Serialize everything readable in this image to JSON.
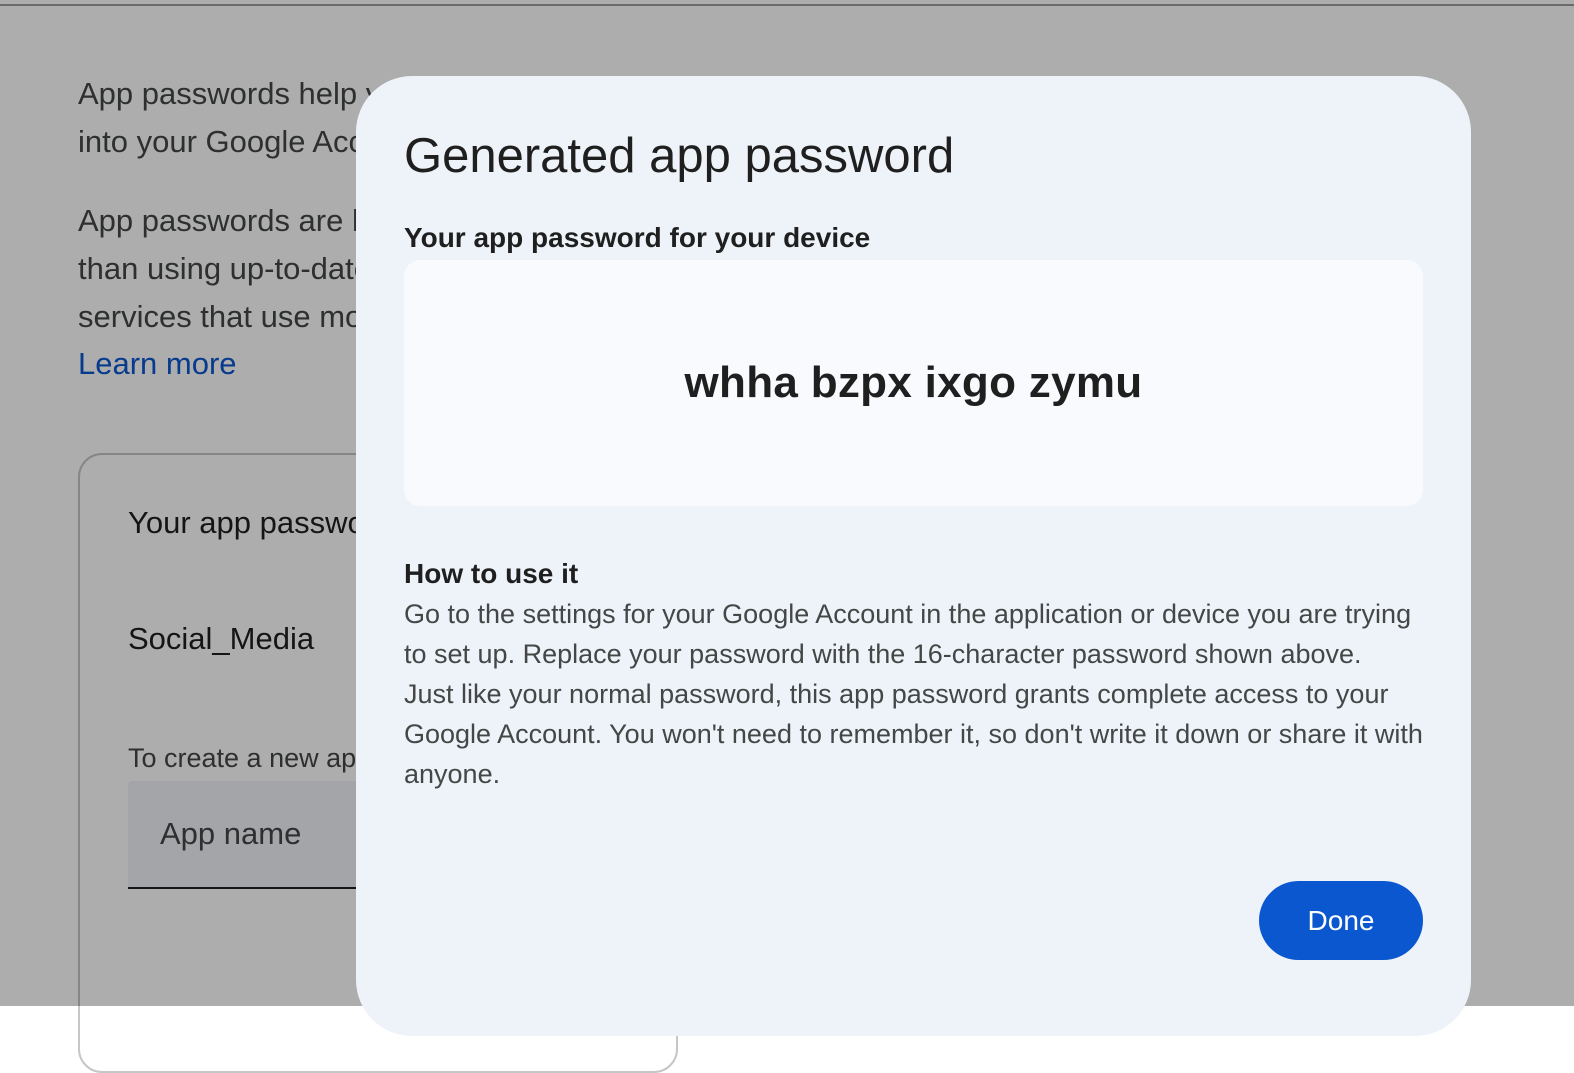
{
  "background": {
    "intro_paragraph_1": "App passwords help you sign into your Google Account on older apps and services that don’t support modern security standards.",
    "intro_paragraph_2": "App passwords are less secure than using up-to-date apps and services that use modern security standards. Before you create an app password, you should check to see if your app needs this in order to sign in.",
    "learn_more": "Learn more",
    "passwords_card": {
      "title": "Your app passwords",
      "apps": [
        "Social_Media"
      ],
      "create_hint": "To create a new app specific password, type a name for it below...",
      "app_name_placeholder": "App name"
    }
  },
  "dialog": {
    "title": "Generated app password",
    "password_label": "Your app password for your device",
    "password": "whha bzpx ixgo zymu",
    "howto_title": "How to use it",
    "howto_paragraph_1": "Go to the settings for your Google Account in the application or device you are trying to set up. Replace your password with the 16-character password shown above.",
    "howto_paragraph_2": "Just like your normal password, this app password grants complete access to your Google Account. You won't need to remember it, so don't write it down or share it with anyone.",
    "done_label": "Done"
  },
  "colors": {
    "accent": "#0b57d0",
    "dialog_surface": "#eef3f9",
    "password_surface": "#f8fafd",
    "scrim": "rgba(0,0,0,0.32)"
  }
}
